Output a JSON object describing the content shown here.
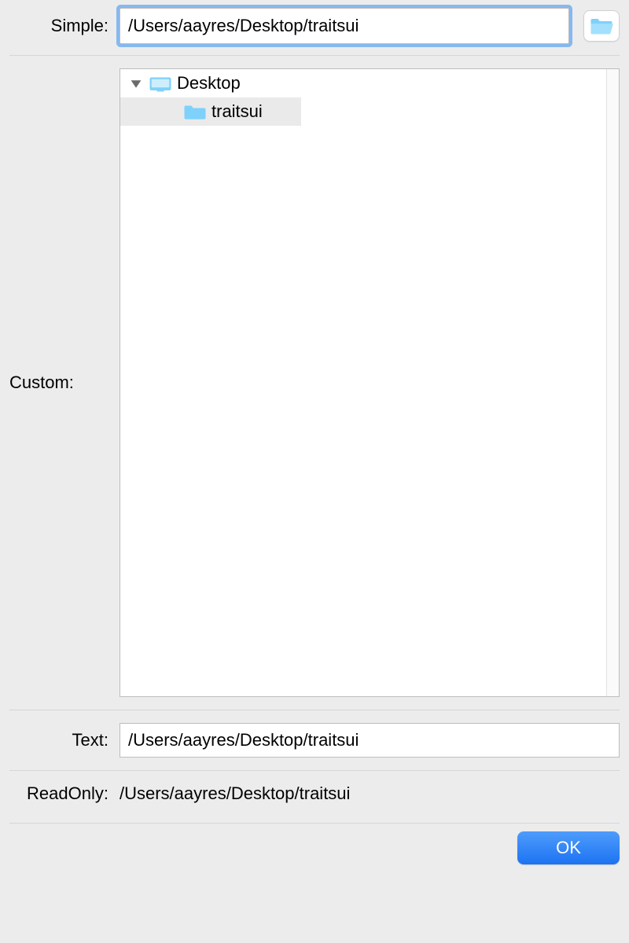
{
  "labels": {
    "simple": "Simple:",
    "custom": "Custom:",
    "text": "Text:",
    "readonly": "ReadOnly:"
  },
  "simple": {
    "value": "/Users/aayres/Desktop/traitsui"
  },
  "custom": {
    "tree": [
      {
        "name": "Desktop",
        "level": 0,
        "icon": "desktop",
        "expanded": true
      },
      {
        "name": "traitsui",
        "level": 1,
        "icon": "folder",
        "selected": true
      }
    ]
  },
  "text": {
    "value": "/Users/aayres/Desktop/traitsui"
  },
  "readonly": {
    "value": "/Users/aayres/Desktop/traitsui"
  },
  "buttons": {
    "ok": "OK"
  },
  "colors": {
    "accent": "#1d73f2",
    "focus": "#86b8ee",
    "folderFill": "#7ed1fb",
    "panelBg": "#ececec"
  }
}
